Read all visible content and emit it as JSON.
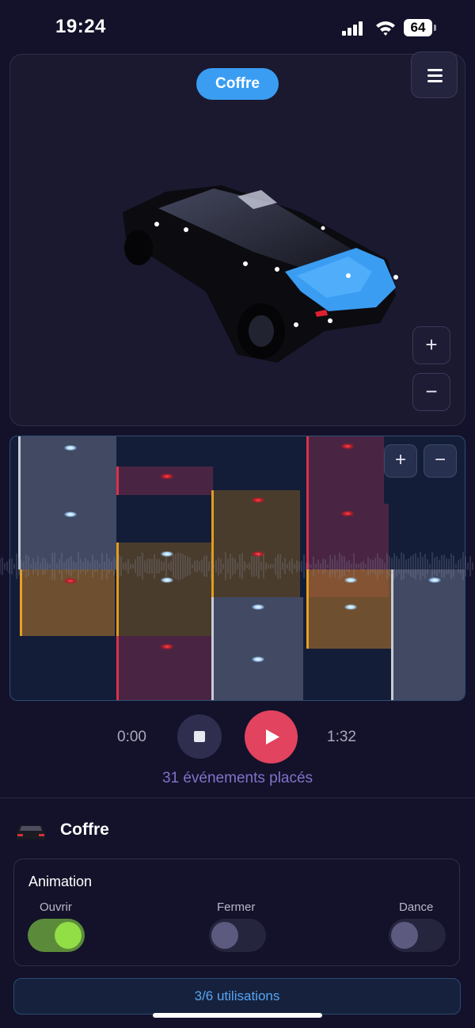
{
  "status_bar": {
    "time": "19:24",
    "battery": "64"
  },
  "viewer": {
    "selected_part": "Coffre",
    "zoom_in": "+",
    "zoom_out": "−"
  },
  "timeline": {
    "zoom_in": "+",
    "zoom_out": "−"
  },
  "player": {
    "current_time": "0:00",
    "total_time": "1:32",
    "events_label": "31 événements placés"
  },
  "details": {
    "title": "Coffre",
    "animation": {
      "title": "Animation",
      "options": [
        {
          "label": "Ouvrir",
          "enabled": true
        },
        {
          "label": "Fermer",
          "enabled": false
        },
        {
          "label": "Dance",
          "enabled": false
        }
      ]
    },
    "usage": "3/6 utilisations"
  },
  "colors": {
    "accent_blue": "#3a9df2",
    "play_red": "#e2435f",
    "toggle_on": "#91de47"
  }
}
